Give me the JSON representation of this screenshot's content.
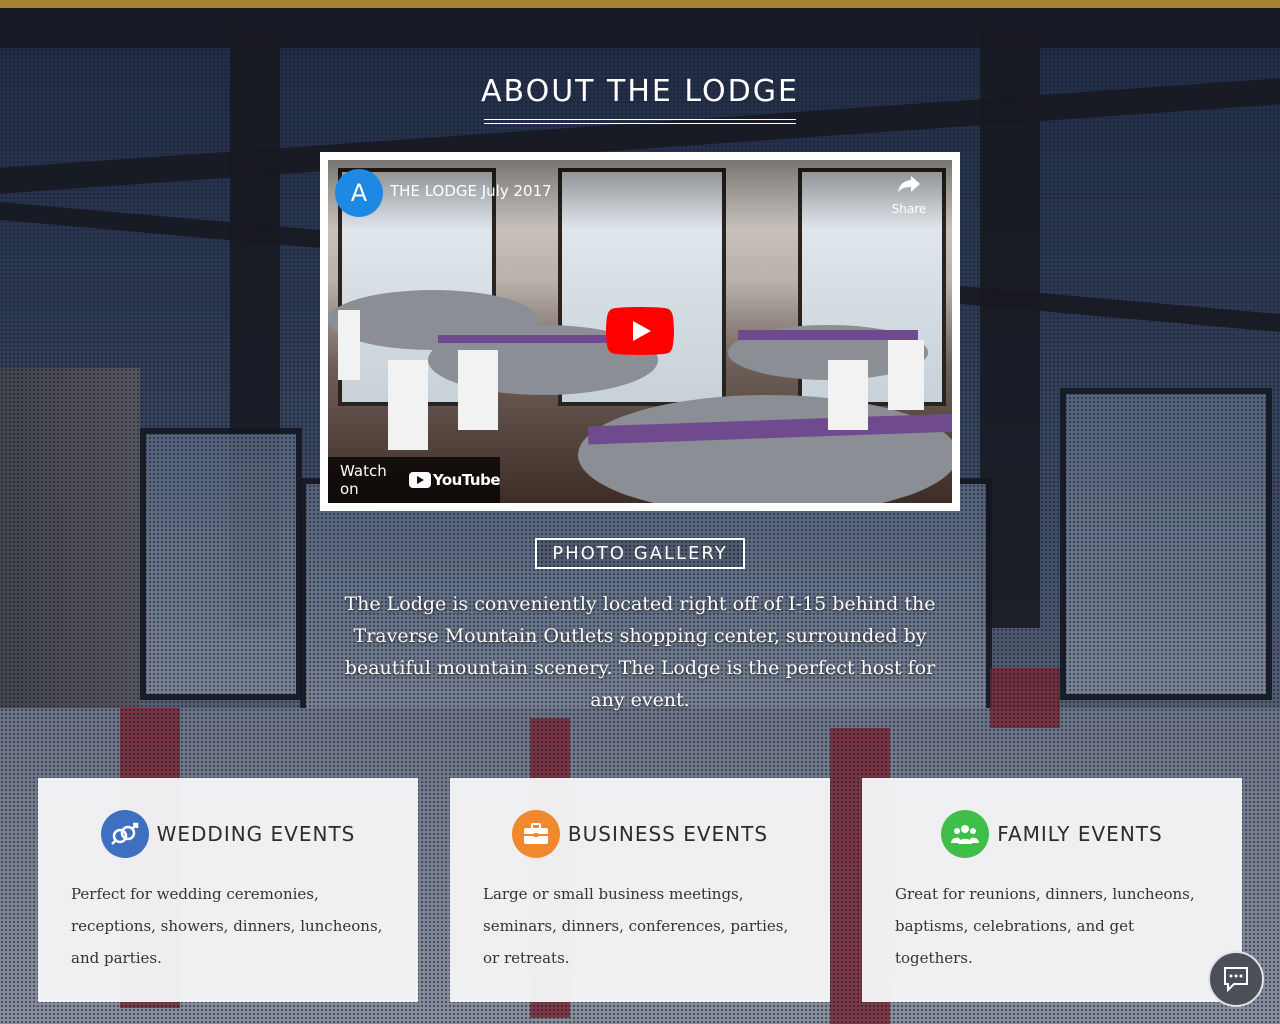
{
  "section": {
    "title": "ABOUT THE LODGE"
  },
  "video": {
    "channel_initial": "A",
    "title": "THE LODGE July 2017",
    "share_label": "Share",
    "watch_on_label": "Watch on",
    "platform_label": "YouTube"
  },
  "gallery": {
    "button_label": "PHOTO GALLERY"
  },
  "intro_text": "The Lodge is conveniently located right off of I-15 behind the Traverse Mountain Outlets shopping center, surrounded by beautiful mountain scenery. The Lodge is the perfect host for any event.",
  "cards": [
    {
      "title": "WEDDING EVENTS",
      "icon": "gender-rings-icon",
      "icon_color": "#3e6fc0",
      "text": "Perfect for wedding ceremonies, receptions, showers, dinners, luncheons, and parties."
    },
    {
      "title": "BUSINESS EVENTS",
      "icon": "briefcase-icon",
      "icon_color": "#f0882d",
      "text": "Large or small business meetings, seminars, dinners, conferences, parties, or retreats."
    },
    {
      "title": "FAMILY EVENTS",
      "icon": "group-icon",
      "icon_color": "#3fbf4a",
      "text": "Great for reunions, dinners, luncheons, baptisms, celebrations, and get togethers."
    }
  ],
  "colors": {
    "top_bar": "#a8832f",
    "youtube_red": "#ff0000"
  },
  "chat": {
    "icon": "chat-icon"
  }
}
